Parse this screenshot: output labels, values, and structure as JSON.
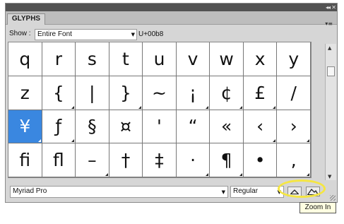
{
  "panel": {
    "tab_label": "GLYPHS",
    "collapse_glyph": "◂◂",
    "close_glyph": "✕",
    "menu_glyph": "▾≡"
  },
  "show": {
    "label": "Show :",
    "value": "Entire Font",
    "unicode": "U+00b8"
  },
  "glyphs": [
    {
      "char": "q",
      "alt": false
    },
    {
      "char": "r",
      "alt": false
    },
    {
      "char": "s",
      "alt": false
    },
    {
      "char": "t",
      "alt": false
    },
    {
      "char": "u",
      "alt": false
    },
    {
      "char": "v",
      "alt": false
    },
    {
      "char": "w",
      "alt": false
    },
    {
      "char": "x",
      "alt": false
    },
    {
      "char": "y",
      "alt": false
    },
    {
      "char": "z",
      "alt": false
    },
    {
      "char": "{",
      "alt": true
    },
    {
      "char": "|",
      "alt": false
    },
    {
      "char": "}",
      "alt": true
    },
    {
      "char": "~",
      "alt": false
    },
    {
      "char": "¡",
      "alt": true
    },
    {
      "char": "¢",
      "alt": true
    },
    {
      "char": "£",
      "alt": true
    },
    {
      "char": "/",
      "alt": false
    },
    {
      "char": "¥",
      "alt": true,
      "selected": true
    },
    {
      "char": "ƒ",
      "alt": true
    },
    {
      "char": "§",
      "alt": false
    },
    {
      "char": "¤",
      "alt": false
    },
    {
      "char": "'",
      "alt": false
    },
    {
      "char": "“",
      "alt": false
    },
    {
      "char": "«",
      "alt": false
    },
    {
      "char": "‹",
      "alt": true
    },
    {
      "char": "›",
      "alt": true
    },
    {
      "char": "ﬁ",
      "alt": false
    },
    {
      "char": "ﬂ",
      "alt": false
    },
    {
      "char": "–",
      "alt": true
    },
    {
      "char": "†",
      "alt": false
    },
    {
      "char": "‡",
      "alt": false
    },
    {
      "char": "·",
      "alt": true
    },
    {
      "char": "¶",
      "alt": true
    },
    {
      "char": "•",
      "alt": false
    },
    {
      "char": ",",
      "alt": true
    }
  ],
  "footer": {
    "font_name": "Myriad Pro",
    "font_style": "Regular",
    "zoom_out_icon": "mountain-small-icon",
    "zoom_in_icon": "mountain-large-icon"
  },
  "tooltip": {
    "text": "Zoom In"
  },
  "colors": {
    "selection": "#3a87e0",
    "highlight_ring": "#f5e642"
  }
}
